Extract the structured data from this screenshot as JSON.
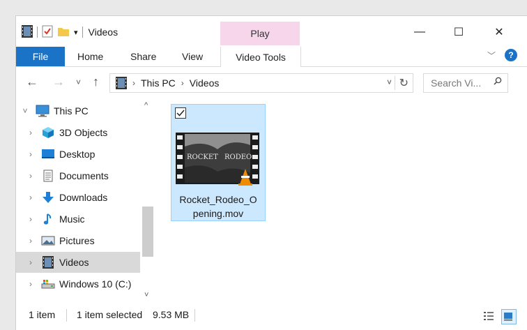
{
  "window": {
    "title": "Videos",
    "contextual_tab_group": "Play",
    "controls": {
      "minimize": "—",
      "maximize": "☐",
      "close": "✕"
    }
  },
  "ribbon": {
    "tabs": [
      {
        "label": "File",
        "active": true
      },
      {
        "label": "Home"
      },
      {
        "label": "Share"
      },
      {
        "label": "View"
      },
      {
        "label": "Video Tools"
      }
    ]
  },
  "address": {
    "crumbs": [
      "This PC",
      "Videos"
    ]
  },
  "search": {
    "placeholder": "Search Vi..."
  },
  "sidebar": {
    "items": [
      {
        "label": "This PC",
        "icon": "computer-icon",
        "expanded": true
      },
      {
        "label": "3D Objects",
        "icon": "cube-3d-icon"
      },
      {
        "label": "Desktop",
        "icon": "desktop-icon"
      },
      {
        "label": "Documents",
        "icon": "document-icon"
      },
      {
        "label": "Downloads",
        "icon": "download-arrow-icon"
      },
      {
        "label": "Music",
        "icon": "music-note-icon"
      },
      {
        "label": "Pictures",
        "icon": "pictures-icon"
      },
      {
        "label": "Videos",
        "icon": "film-icon",
        "selected": true
      },
      {
        "label": "Windows 10 (C:)",
        "icon": "drive-icon"
      }
    ]
  },
  "files": [
    {
      "name_line1": "Rocket_Rodeo_O",
      "name_line2": "pening.mov",
      "thumb_text_left": "ROCKET",
      "thumb_text_right": "RODEO",
      "checked": true,
      "selected": true
    }
  ],
  "status": {
    "count": "1 item",
    "selected": "1 item selected",
    "size": "9.53 MB"
  },
  "colors": {
    "accent": "#1a73c7",
    "selection_bg": "#cce8ff",
    "selection_border": "#99d1ff",
    "play_tab": "#f7d5ea",
    "sidebar_selected": "#d9d9d9"
  }
}
